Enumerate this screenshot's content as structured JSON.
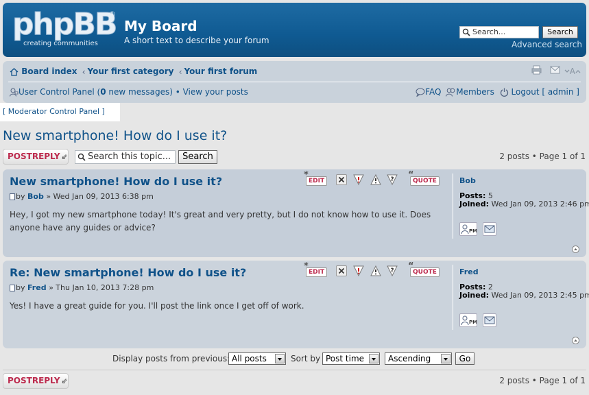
{
  "header": {
    "logo_text": "phpBB",
    "logo_reg": "®",
    "logo_tagline": "creating   communities",
    "site_title": "My Board",
    "site_description": "A short text to describe your forum",
    "search_placeholder": "Search...",
    "search_button": "Search",
    "advanced_search": "Advanced search"
  },
  "navbar": {
    "breadcrumbs": [
      "Board index",
      "Your first category",
      "Your first forum"
    ],
    "breadcrumb_sep": "‹",
    "font_size_label": "A",
    "ucp_label": "User Control Panel",
    "messages_open": " (",
    "new_messages_count": "0",
    "new_messages_label": " new messages)",
    "bullet": " • ",
    "view_posts": "View your posts",
    "faq": "FAQ",
    "members": "Members",
    "logout": "Logout [ admin ]"
  },
  "mcp_label": "[ Moderator Control Panel ]",
  "topic": {
    "title": "New smartphone! How do I use it?",
    "post_reply": "POSTREPLY",
    "search_placeholder": "Search this topic...",
    "search_button": "Search",
    "pagination": "2 posts • Page 1 of 1"
  },
  "posts": [
    {
      "title": "New smartphone! How do I use it?",
      "meta_prefix": "by ",
      "author": "Bob",
      "date": " » Wed Jan 09, 2013 6:38 pm",
      "body": "Hey, I got my new smartphone today! It's great and very pretty, but I do not know how to use it. Does anyone have any guides or advice?",
      "profile_name": "Bob",
      "posts_label": "Posts:",
      "posts_count": " 5",
      "joined_label": "Joined:",
      "joined_value": " Wed Jan 09, 2013 2:46 pm"
    },
    {
      "title": "Re: New smartphone! How do I use it?",
      "meta_prefix": "by ",
      "author": "Fred",
      "date": " » Thu Jan 10, 2013 7:28 pm",
      "body": "Yes! I have a great guide for you. I'll post the link once I get off of work.",
      "profile_name": "Fred",
      "posts_label": "Posts:",
      "posts_count": " 2",
      "joined_label": "Joined:",
      "joined_value": " Wed Jan 09, 2013 2:45 pm"
    }
  ],
  "post_buttons": {
    "edit": "EDIT",
    "quote": "QUOTE",
    "pm": "PM"
  },
  "display_options": {
    "label": "Display posts from previous:",
    "days_value": "All posts",
    "sort_label": "Sort by",
    "sort_value": "Post time",
    "order_value": "Ascending",
    "go": "Go"
  },
  "colors": {
    "header_bg": "#1e6ba3",
    "link": "#105289",
    "post_reply": "#bc2a4d",
    "post_bg": "#c5ced9"
  }
}
